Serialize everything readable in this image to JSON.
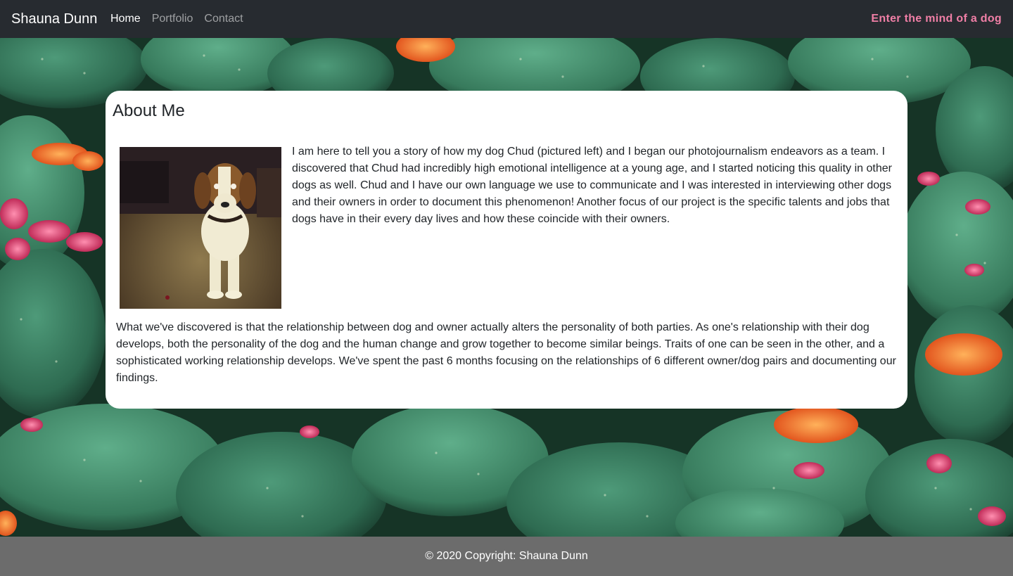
{
  "navbar": {
    "brand": "Shauna Dunn",
    "links": [
      {
        "label": "Home",
        "active": true
      },
      {
        "label": "Portfolio",
        "active": false
      },
      {
        "label": "Contact",
        "active": false
      }
    ],
    "tagline": "Enter the mind of a dog",
    "tagline_color": "#f07fa6",
    "bg_color": "#272b30"
  },
  "about": {
    "title": "About Me",
    "paragraph1": "I am here to tell you a story of how my dog Chud (pictured left) and I began our photojournalism endeavors as a team. I discovered that Chud had incredibly high emotional intelligence at a young age, and I started noticing this quality in other dogs as well. Chud and I have our own language we use to communicate and I was interested in interviewing other dogs and their owners in order to document this phenomenon! Another focus of our project is the specific talents and jobs that dogs have in their every day lives and how these coincide with their owners.",
    "paragraph2": "What we've discovered is that the relationship between dog and owner actually alters the personality of both parties. As one's relationship with their dog develops, both the personality of the dog and the human change and grow together to become similar beings. Traits of one can be seen in the other, and a sophisticated working relationship develops. We've spent the past 6 months focusing on the relationships of 6 different owner/dog pairs and documenting our findings."
  },
  "footer": {
    "copyright": "© 2020 Copyright: Shauna Dunn",
    "bg_color": "#6c6c6c"
  }
}
